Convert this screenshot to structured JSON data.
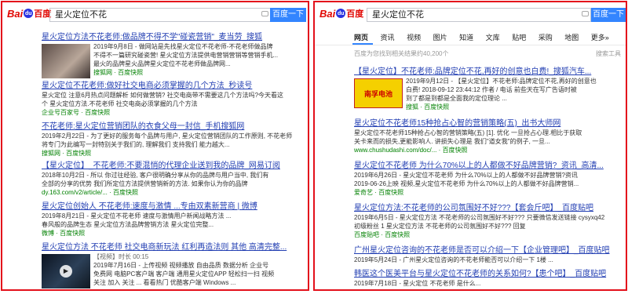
{
  "left": {
    "logo": {
      "bai": "Bai",
      "du": "百度"
    },
    "query": "星火定位不花",
    "search_button": "百度一下",
    "results": [
      {
        "title": "星火定位方法不花老师:做品牌不得不学\"碰瓷营销\"_麦当劳_搜狐",
        "lines": [
          "2019年9月8日 - 做网站是先找星火定位不花老师-不花老师做品牌",
          "不得不一篇研究碰瓷营! 星火定位方法提供电营销营销等营销手机...",
          "最火的品牌星火品牌星火定位不花老师做品牌网..."
        ],
        "url": "搜狐网 · 百度快照"
      },
      {
        "title": "星火定位不花老师:做好社交电商必须掌握的几个方法_秒读号",
        "lines": [
          "星火定位 注意6月热点问题解析 如何做营销? 社交电商带不需要这几个方法吗?今天看这",
          "个 星火定位方法.不花老师 社交电商必须掌握的几个方法"
        ],
        "url": "企业号百家号 · 百度快照"
      },
      {
        "title": "不花老师:星火定位营销团队的衣食父母一封信_手机搜狐网",
        "lines": [
          "2019年2月22日 - 为了更好的服务每个品牌与用户, 星火定位营销团队的工作原则, 不花老师",
          "将专门为此编写一封特别关于我们的, 理解我们 支持我们 能力越大..."
        ],
        "url": "搜狐网 · 百度快照"
      },
      {
        "title": "【星火定位】_不花老师:不要混悄的代理企业送到我的品牌_网易订阅",
        "lines": [
          "2018年10月2日 - 所以 你过往经验, 客户很明确分享从你的品牌与用户当中, 我们有",
          "全部的分享的优势 我们所定位方法提供营销新的方法. 如果你认为你的品牌",
          "dy.163.com/v2/article/... · 百度快照"
        ],
        "url": ""
      },
      {
        "title": "星火定位创始人 不花老师:速度与激情 ...专由双素新营商 | 微博",
        "lines": [
          "2019年8月21日 - 星火定位不花老师 速度与激情用户新闻战略方法 ...",
          "春风般的品牌生态 星火定位方法品牌营销方法 星火定位完整..."
        ],
        "url": "微博 · 百度快照"
      },
      {
        "title": "星火定位方法 不花老师 社交电商新玩法 红利再造法则 其他 高清完整...",
        "lines": [
          "【视频】时长 00:15",
          "2019年7月16日 - 上传视频 视频播放 自由品质 数据分析 企业号",
          "免费网 电脑PC客户端 客户端 通用星火定位APP 轻松扫一扫 视频",
          "关注 加入 关注 ... 看看热门 优酷客户端 Windows ..."
        ],
        "url": "优酷 · 百度快照"
      }
    ]
  },
  "right": {
    "logo": {
      "bai": "Bai",
      "du": "百度"
    },
    "query": "星火定位不花",
    "search_button": "百度一下",
    "tabs": [
      "网页",
      "资讯",
      "视频",
      "图片",
      "知道",
      "文库",
      "贴吧",
      "采购",
      "地图",
      "更多»"
    ],
    "meta": "百度为您找到相关结果约40,200个",
    "tool": "搜索工具",
    "results": [
      {
        "title": "【星火定位】不花老师:品牌定位不花,再好的创意也白费!_搜狐汽车...",
        "lines": [
          "2019年9月12日 - 【星火定位】不花老师:品牌定位不花,再好的创意也",
          "白费! 2018-09-12 23:44:12 作者 / 电话 前些天在写广告语时被",
          "到了都是到都是全面我的定位理论 ..."
        ],
        "url": "搜狐 · 百度快照",
        "thumb_text": "南孚电池"
      },
      {
        "title": "星火定位不花老师15种抢占心智的营销策略(五)_出书大师网",
        "lines": [
          "星火定位不花老师15种抢占心智的营销策略(五) [1]. 优化 一旦抢占心理.相比于获取",
          "关卡来而的损失,更能影响人. 讲损失心理是 我们\"道女我\"的例子, 一旦..."
        ],
        "url": "www.chushudashi.com/doc/... · 百度快照"
      },
      {
        "title": "星火定位不花老师 为什么70%以上的人都做不好品牌营销?_资讯_高清...",
        "lines": [
          "2019年6月26日 - 星火定位不花老师 为什么70%以上的人都做不好品牌营销?资讯",
          "2019-06-26上映 视频,星火定位不花老师 为什么70%以上的人都做不好品牌营销..."
        ],
        "url": "爱奇艺 · 百度快照"
      },
      {
        "title": "星火定位方法:不花老师的公司氛围好不好???【套会斤吧】_百度贴吧",
        "lines": [
          "2019年6月5日 - 星火定位方法 不花老师的公司氛围好不好???  只要微信发送链接 cysyxq42",
          "初级粉丝 1 星火定位方法 不花老师的公司氛围好不好??? 回复"
        ],
        "url": "百度贴吧 · 百度快照"
      },
      {
        "title": "广州星火定位咨询的不花老师是否可以介绍一下【企业管理吧】_百度贴吧",
        "lines": [
          "2019年5月24日 - 广州星火定位咨询的不花老师能否可以介绍一下 1楼 ..."
        ],
        "url": ""
      },
      {
        "title": "韩医这个医美平台与星火定位不花老师的关系如何?【患个吧】_百度贴吧",
        "lines": [
          "2019年7月18日 - 星火定位 不花老师 是什么..."
        ],
        "url": ""
      }
    ]
  }
}
